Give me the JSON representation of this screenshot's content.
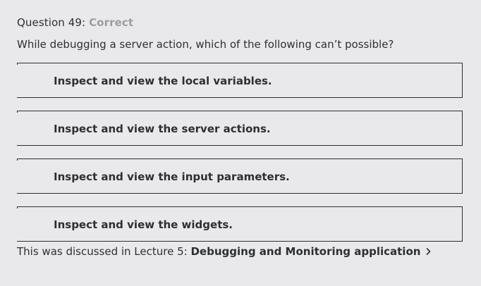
{
  "question": {
    "number_label": "Question 49:",
    "status": "Correct",
    "text": "While debugging a server action, which of the following can’t possible?"
  },
  "options": [
    {
      "label": "Inspect and view the local variables."
    },
    {
      "label": "Inspect and view the server actions."
    },
    {
      "label": "Inspect and view the input parameters."
    },
    {
      "label": "Inspect and view the widgets."
    }
  ],
  "footer": {
    "prefix": "This was discussed in Lecture 5:",
    "link_text": "Debugging and Monitoring application",
    "link_icon": "chevron-right-icon"
  },
  "colors": {
    "background": "#e9e9eb",
    "text": "#2d2f31",
    "status_muted": "#9b9da3"
  }
}
